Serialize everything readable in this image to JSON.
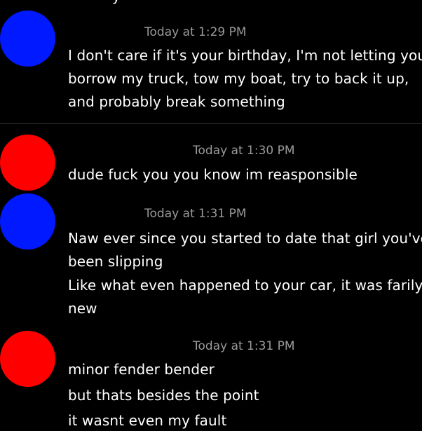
{
  "colors": {
    "background": "#000000",
    "text": "#ffffff",
    "timestamp": "#9a9a9a",
    "avatar_blue": "#0019ff",
    "avatar_red": "#ff0000"
  },
  "top_cutoff_text": "y",
  "messages": [
    {
      "avatar_color": "#0019ff",
      "timestamp": "Today at 1:29 PM",
      "lines": [
        "I don't care if it's your birthday, I'm not letting you",
        "borrow my truck, tow my boat, try to back it up,",
        "and probably break something"
      ]
    },
    {
      "avatar_color": "#ff0000",
      "timestamp": "Today at 1:30 PM",
      "lines": [
        "dude fuck you you know im reasponsible"
      ]
    },
    {
      "avatar_color": "#0019ff",
      "timestamp": "Today at 1:31 PM",
      "lines": [
        "Naw ever since you started to date that girl you've",
        "been slipping",
        "Like what even happened to your car, it was farily",
        "new"
      ]
    },
    {
      "avatar_color": "#ff0000",
      "timestamp": "Today at 1:31 PM",
      "lines": [
        "minor fender bender",
        "but thats besides the point",
        "it wasnt even my fault"
      ]
    }
  ]
}
